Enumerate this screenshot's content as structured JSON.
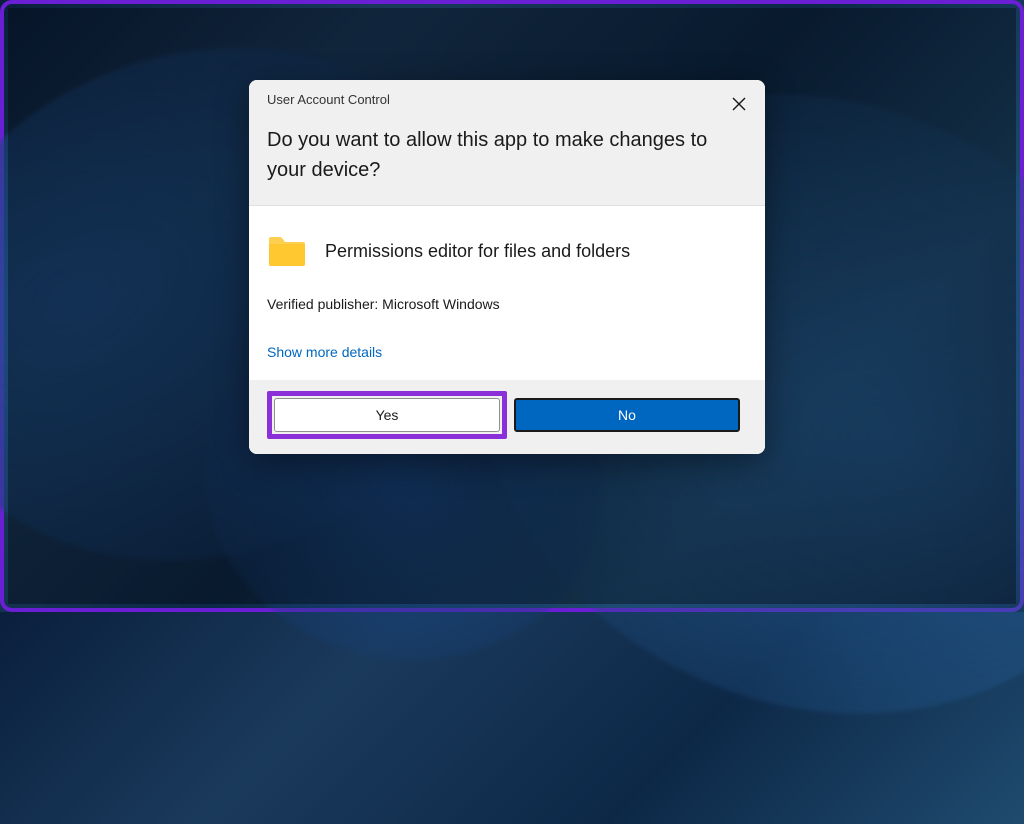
{
  "dialog": {
    "title_small": "User Account Control",
    "title_large": "Do you want to allow this app to make changes to your device?",
    "app_name": "Permissions editor for files and folders",
    "publisher": "Verified publisher: Microsoft Windows",
    "details_link": "Show more details",
    "yes_label": "Yes",
    "no_label": "No"
  }
}
